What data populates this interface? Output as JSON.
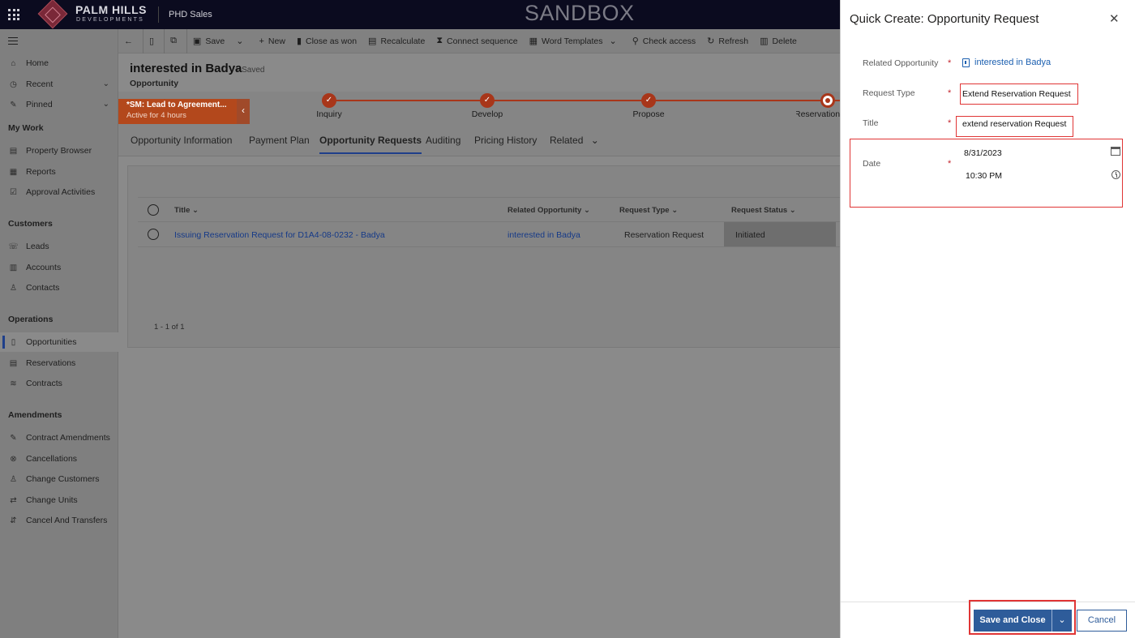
{
  "header": {
    "logo_line1": "PALM HILLS",
    "logo_line2": "DEVELOPMENTS",
    "app_name": "PHD Sales",
    "environment": "SANDBOX"
  },
  "nav": {
    "items_top": [
      {
        "label": "Home",
        "icon": "home-icon"
      },
      {
        "label": "Recent",
        "icon": "clock-icon",
        "expandable": true
      },
      {
        "label": "Pinned",
        "icon": "pin-icon",
        "expandable": true
      }
    ],
    "sections": [
      {
        "title": "My Work",
        "items": [
          {
            "label": "Property Browser",
            "icon": "building-icon"
          },
          {
            "label": "Reports",
            "icon": "report-icon"
          },
          {
            "label": "Approval Activities",
            "icon": "approval-icon"
          }
        ]
      },
      {
        "title": "Customers",
        "items": [
          {
            "label": "Leads",
            "icon": "leads-icon"
          },
          {
            "label": "Accounts",
            "icon": "accounts-icon"
          },
          {
            "label": "Contacts",
            "icon": "contact-icon"
          }
        ]
      },
      {
        "title": "Operations",
        "items": [
          {
            "label": "Opportunities",
            "icon": "opportunity-icon",
            "selected": true
          },
          {
            "label": "Reservations",
            "icon": "reservation-icon"
          },
          {
            "label": "Contracts",
            "icon": "contract-icon"
          }
        ]
      },
      {
        "title": "Amendments",
        "items": [
          {
            "label": "Contract Amendments",
            "icon": "amend-icon"
          },
          {
            "label": "Cancellations",
            "icon": "cancel-circle-icon"
          },
          {
            "label": "Change Customers",
            "icon": "change-customer-icon"
          },
          {
            "label": "Change Units",
            "icon": "change-units-icon"
          },
          {
            "label": "Cancel And Transfers",
            "icon": "transfer-icon"
          }
        ]
      }
    ]
  },
  "commands": {
    "save": "Save",
    "new": "New",
    "close_as_won": "Close as won",
    "recalculate": "Recalculate",
    "connect_sequence": "Connect sequence",
    "word_templates": "Word Templates",
    "check_access": "Check access",
    "refresh": "Refresh",
    "delete": "Delete"
  },
  "record": {
    "title": "interested in Badya",
    "saved": "- Saved",
    "entity": "Opportunity"
  },
  "bpf": {
    "flag_title": "*SM: Lead to Agreement...",
    "flag_sub": "Active for 4 hours",
    "stages": [
      {
        "label": "Inquiry",
        "done": true
      },
      {
        "label": "Develop",
        "done": true
      },
      {
        "label": "Propose",
        "done": true
      },
      {
        "label": "Reservation",
        "active": true
      }
    ]
  },
  "tabs": [
    {
      "label": "Opportunity Information"
    },
    {
      "label": "Payment Plan"
    },
    {
      "label": "Opportunity Requests",
      "active": true
    },
    {
      "label": "Auditing"
    },
    {
      "label": "Pricing History"
    },
    {
      "label": "Related"
    }
  ],
  "grid": {
    "columns": [
      "Title",
      "Related Opportunity",
      "Request Type",
      "Request Status"
    ],
    "rows": [
      {
        "title": "Issuing Reservation Request for D1A4-08-0232 - Badya",
        "related_opportunity": "interested in Badya",
        "request_type": "Reservation Request",
        "status": "Initiated"
      }
    ],
    "pager": "1 - 1 of 1"
  },
  "quick_create": {
    "title": "Quick Create: Opportunity Request",
    "fields": {
      "related_opportunity_label": "Related Opportunity",
      "related_opportunity_value": "interested in Badya",
      "request_type_label": "Request Type",
      "request_type_value": "Extend Reservation Request",
      "title_label": "Title",
      "title_value": "extend reservation Request",
      "date_label": "Date",
      "date_value": "8/31/2023",
      "time_value": "10:30 PM"
    },
    "required_mark": "*",
    "save_and_close": "Save and Close",
    "cancel": "Cancel"
  }
}
